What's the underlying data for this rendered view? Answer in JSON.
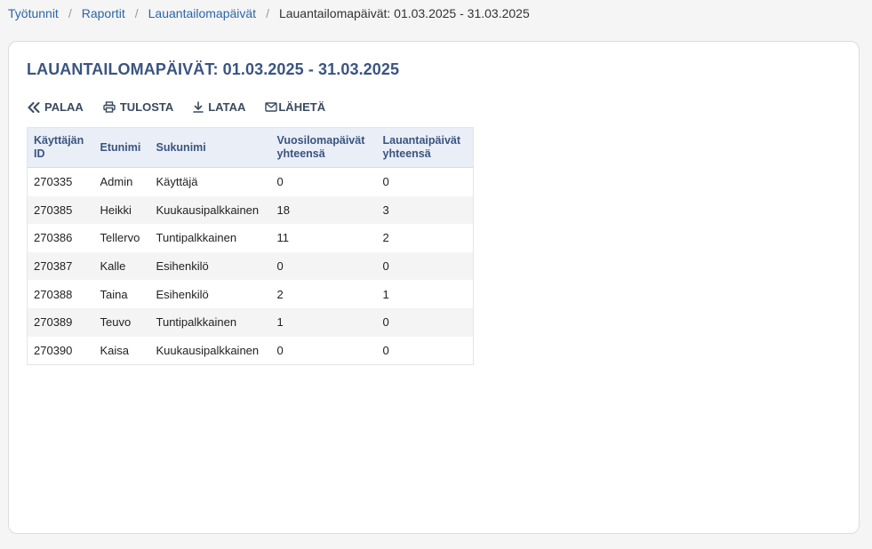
{
  "breadcrumb": {
    "items": [
      "Työtunnit",
      "Raportit",
      "Lauantailomapäivät"
    ],
    "separator": "/",
    "current": "Lauantailomapäivät: 01.03.2025 - 31.03.2025"
  },
  "page": {
    "title": "LAUANTAILOMAPÄIVÄT: 01.03.2025 - 31.03.2025"
  },
  "toolbar": {
    "back": {
      "label": "PALAA",
      "icon": "double-chevron-left-icon"
    },
    "print": {
      "label": "TULOSTA",
      "icon": "printer-icon"
    },
    "download": {
      "label": "LATAA",
      "icon": "download-icon"
    },
    "send": {
      "label": "LÄHETÄ",
      "icon": "envelope-icon"
    }
  },
  "table": {
    "headers": [
      [
        "Käyttäjän",
        "ID"
      ],
      [
        "Etunimi"
      ],
      [
        "Sukunimi"
      ],
      [
        "Vuosilomapäivät",
        "yhteensä"
      ],
      [
        "Lauantaipäivät",
        "yhteensä"
      ]
    ],
    "rows": [
      [
        "270335",
        "Admin",
        "Käyttäjä",
        "0",
        "0"
      ],
      [
        "270385",
        "Heikki",
        "Kuukausipalkkainen",
        "18",
        "3"
      ],
      [
        "270386",
        "Tellervo",
        "Tuntipalkkainen",
        "11",
        "2"
      ],
      [
        "270387",
        "Kalle",
        "Esihenkilö",
        "0",
        "0"
      ],
      [
        "270388",
        "Taina",
        "Esihenkilö",
        "2",
        "1"
      ],
      [
        "270389",
        "Teuvo",
        "Tuntipalkkainen",
        "1",
        "0"
      ],
      [
        "270390",
        "Kaisa",
        "Kuukausipalkkainen",
        "0",
        "0"
      ]
    ]
  },
  "colors": {
    "link": "#2a66a8",
    "title": "#3b5480",
    "header_bg": "#e9eef7",
    "stripe": "#f4f4f4"
  }
}
